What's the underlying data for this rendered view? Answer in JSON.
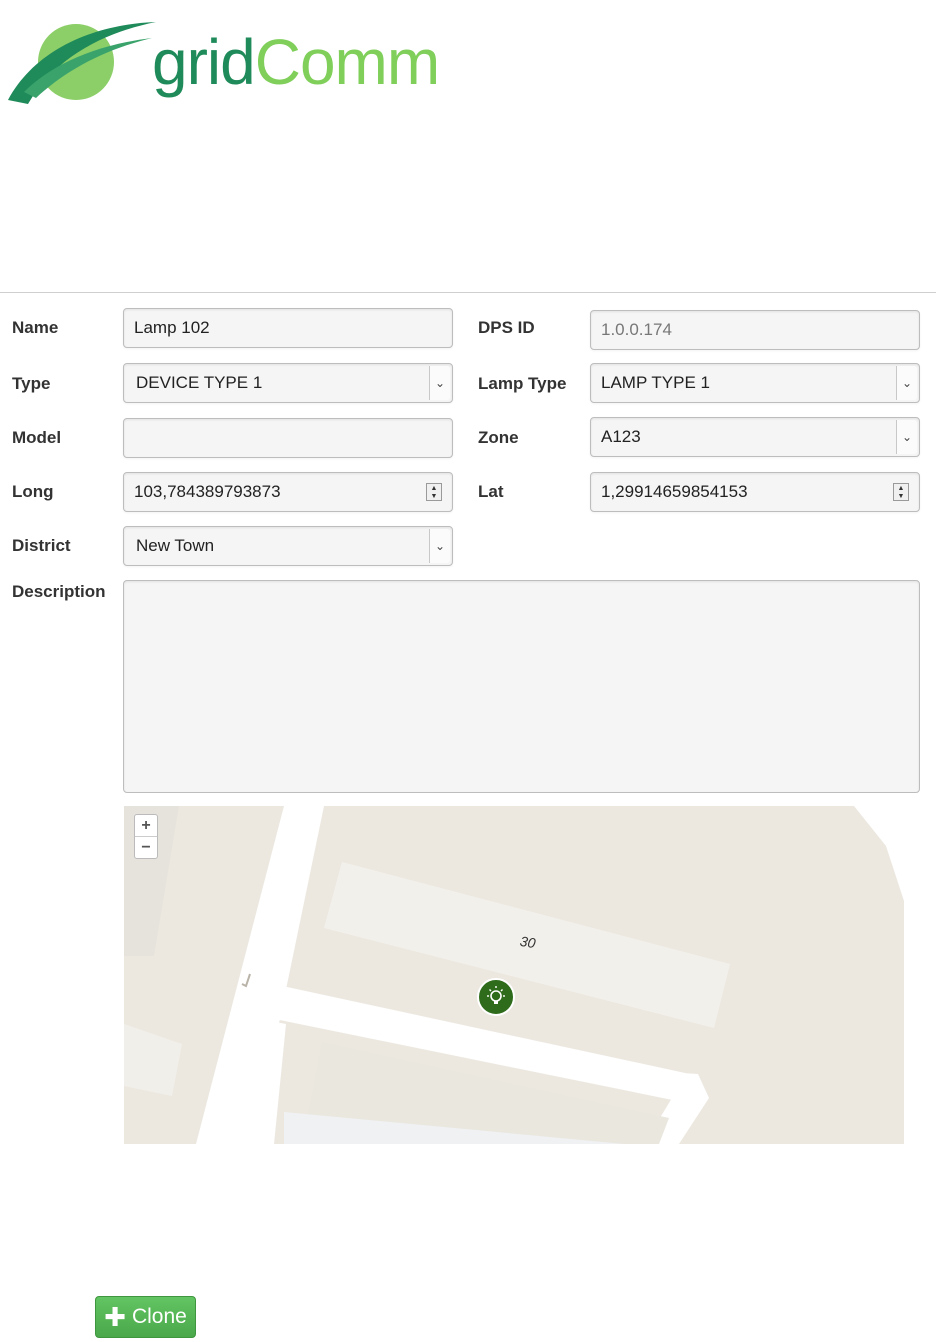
{
  "brand": {
    "word1": "grid",
    "word2": "Comm"
  },
  "form": {
    "name": {
      "label": "Name",
      "value": "Lamp 102"
    },
    "dps_id": {
      "label": "DPS ID",
      "value": "1.0.0.174"
    },
    "type": {
      "label": "Type",
      "value": "DEVICE TYPE 1"
    },
    "lamp_type": {
      "label": "Lamp Type",
      "value": "LAMP TYPE 1"
    },
    "model": {
      "label": "Model",
      "value": ""
    },
    "zone": {
      "label": "Zone",
      "value": "A123"
    },
    "long": {
      "label": "Long",
      "value": "103,784389793873"
    },
    "lat": {
      "label": "Lat",
      "value": "1,29914659854153"
    },
    "district": {
      "label": "District",
      "value": "New Town"
    },
    "description": {
      "label": "Description",
      "value": ""
    }
  },
  "map": {
    "building_label": "30",
    "zoom_in": "+",
    "zoom_out": "−",
    "marker": "lamp-marker-icon"
  },
  "actions": {
    "clone_label": "Clone",
    "clone_icon": "plus-icon",
    "clone_color": "#5cb85c"
  }
}
